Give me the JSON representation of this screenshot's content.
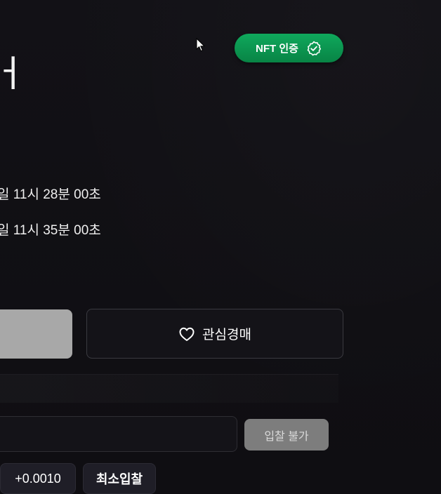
{
  "badge": {
    "label": "NFT 인증",
    "icon": "check-circle-icon"
  },
  "title": {
    "visible_glyph": "ㅓ"
  },
  "schedule": {
    "start_partial": "일 11시 28분 00초",
    "end_partial": "일 11시 35분 00초"
  },
  "actions": {
    "watch_label": "관심경매",
    "watch_icon": "heart-icon"
  },
  "bid": {
    "input_value": "",
    "status_button_label": "입찰 불가",
    "increment_chip": "+0.0010",
    "min_bid_chip": "최소입찰"
  },
  "colors": {
    "background": "#111014",
    "badge_green": "#0fa85c",
    "disabled_gray": "#7d7d7d"
  }
}
